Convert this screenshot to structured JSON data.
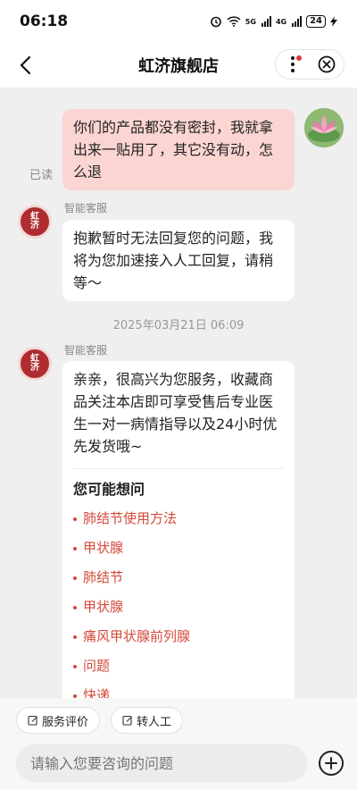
{
  "status_bar": {
    "time": "06:18",
    "signal_1_label": "5G",
    "signal_2_label": "4G",
    "battery": "24"
  },
  "header": {
    "title": "虹济旗舰店"
  },
  "messages": {
    "user_text": "你们的产品都没有密封，我就拿出来一贴用了，其它没有动，怎么退",
    "read_label": "已读",
    "bot_name_1": "智能客服",
    "bot_text_1": "抱歉暂时无法回复您的问题，我将为您加速接入人工回复，请稍等～",
    "timestamp": "2025年03月21日 06:09",
    "bot_name_2": "智能客服",
    "bot_text_2": "亲亲，很高兴为您服务，收藏商品关注本店即可享受售后专业医生一对一病情指导以及24小时优先发货哦~",
    "faq_title": "您可能想问",
    "faq_items": [
      "肺结节使用方法",
      "甲状腺",
      "肺结节",
      "甲状腺",
      "痛风甲状腺前列腺",
      "问题",
      "快递"
    ],
    "bot_avatar_text": [
      "虹",
      "济"
    ]
  },
  "bottom": {
    "quick_actions": [
      "服务评价",
      "转人工"
    ],
    "input_placeholder": "请输入您要咨询的问题"
  },
  "colors": {
    "user_bubble": "#fbd5d2",
    "link_red": "#d44a3a",
    "avatar_red": "#b02c30",
    "background": "#efefef"
  }
}
